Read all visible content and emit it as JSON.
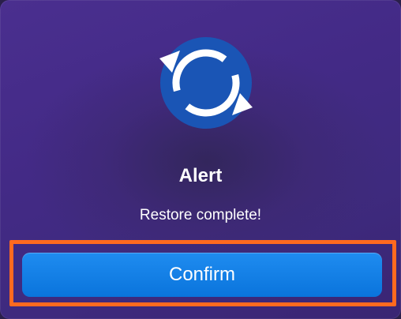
{
  "dialog": {
    "icon": "sync-arrows-icon",
    "title": "Alert",
    "message": "Restore complete!",
    "confirm_label": "Confirm"
  },
  "colors": {
    "background": "#432a86",
    "icon_circle": "#1a55b5",
    "button": "#0a74dc",
    "highlight": "#ff6a1f"
  }
}
